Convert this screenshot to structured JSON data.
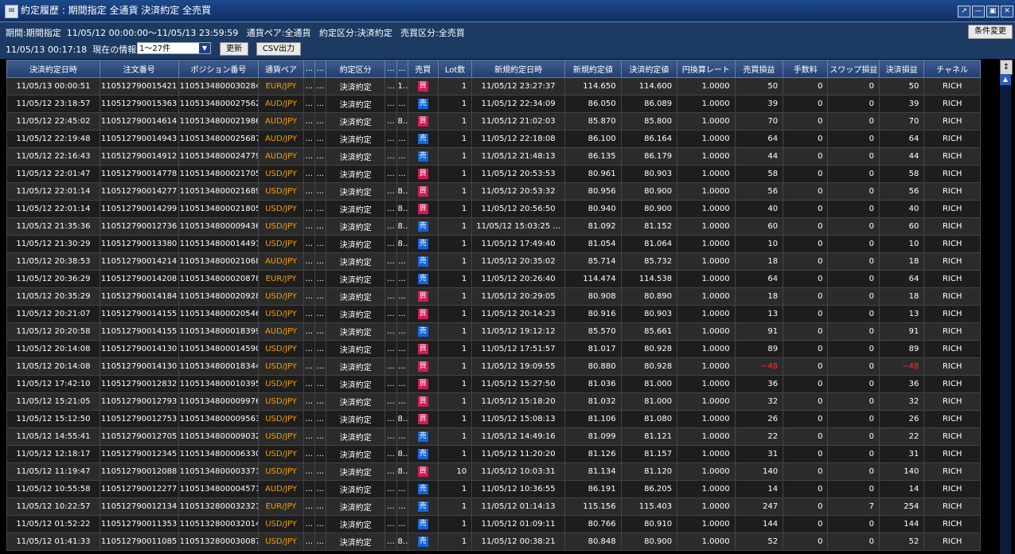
{
  "window": {
    "title": "約定履歴 : 期間指定 全通貨 決済約定 全売買",
    "buttons": [
      "↗",
      "—",
      "▣",
      "✕"
    ]
  },
  "info": {
    "period_line": "期間:期間指定  11/05/12 00:00:00〜11/05/13 23:59:59   通貨ペア:全通貨   約定区分:決済約定   売買区分:全売買",
    "now_line": "11/05/13 00:17:18  現在の情報",
    "condition_button": "条件変更",
    "range_select": "1〜27件",
    "refresh_button": "更新",
    "csv_button": "CSV出力"
  },
  "table": {
    "columns": [
      "決済約定日時",
      "注文番号",
      "ポジション番号",
      "通貨ペア",
      "...",
      "...",
      "約定区分",
      "...",
      "...",
      "売買",
      "Lot数",
      "新規約定日時",
      "新規約定値",
      "決済約定値",
      "円換算レート",
      "売買損益",
      "手数料",
      "スワップ損益",
      "決済損益",
      "チャネル"
    ],
    "rows": [
      [
        "11/05/13 00:00:51",
        "110512790015421 7",
        "1105134800030284",
        "EUR/JPY",
        "...",
        "...",
        "決済約定",
        "...",
        "1...",
        "買",
        "1",
        "11/05/12 23:27:37",
        "114.650",
        "114.600",
        "1.0000",
        "50",
        "0",
        "0",
        "50",
        "RICH"
      ],
      [
        "11/05/12 23:18:57",
        "110512790015363 1",
        "1105134800027562",
        "AUD/JPY",
        "...",
        "...",
        "決済約定",
        "...",
        "...",
        "売",
        "1",
        "11/05/12 22:34:09",
        "86.050",
        "86.089",
        "1.0000",
        "39",
        "0",
        "0",
        "39",
        "RICH"
      ],
      [
        "11/05/12 22:45:02",
        "110512790014614 7",
        "1105134800021986",
        "AUD/JPY",
        "...",
        "...",
        "決済約定",
        "...",
        "8...",
        "買",
        "1",
        "11/05/12 21:02:03",
        "85.870",
        "85.800",
        "1.0000",
        "70",
        "0",
        "0",
        "70",
        "RICH"
      ],
      [
        "11/05/12 22:19:48",
        "110512790014943 9",
        "1105134800025687",
        "AUD/JPY",
        "...",
        "...",
        "決済約定",
        "...",
        "...",
        "売",
        "1",
        "11/05/12 22:18:08",
        "86.100",
        "86.164",
        "1.0000",
        "64",
        "0",
        "0",
        "64",
        "RICH"
      ],
      [
        "11/05/12 22:16:43",
        "110512790014912 4",
        "1105134800024779",
        "AUD/JPY",
        "...",
        "...",
        "決済約定",
        "...",
        "...",
        "売",
        "1",
        "11/05/12 21:48:13",
        "86.135",
        "86.179",
        "1.0000",
        "44",
        "0",
        "0",
        "44",
        "RICH"
      ],
      [
        "11/05/12 22:01:47",
        "110512790014778 4",
        "1105134800021705",
        "USD/JPY",
        "...",
        "...",
        "決済約定",
        "...",
        "...",
        "買",
        "1",
        "11/05/12 20:53:53",
        "80.961",
        "80.903",
        "1.0000",
        "58",
        "0",
        "0",
        "58",
        "RICH"
      ],
      [
        "11/05/12 22:01:14",
        "110512790014277 5",
        "1105134800021689",
        "USD/JPY",
        "...",
        "...",
        "決済約定",
        "...",
        "8...",
        "買",
        "1",
        "11/05/12 20:53:32",
        "80.956",
        "80.900",
        "1.0000",
        "56",
        "0",
        "0",
        "56",
        "RICH"
      ],
      [
        "11/05/12 22:01:14",
        "110512790014299 1",
        "1105134800021805",
        "USD/JPY",
        "...",
        "...",
        "決済約定",
        "...",
        "8...",
        "買",
        "1",
        "11/05/12 20:56:50",
        "80.940",
        "80.900",
        "1.0000",
        "40",
        "0",
        "0",
        "40",
        "RICH"
      ],
      [
        "11/05/12 21:35:36",
        "110512790012736 7",
        "1105134800009436",
        "USD/JPY",
        "...",
        "...",
        "決済約定",
        "...",
        "8...",
        "売",
        "1",
        "11/05/12 15:03:25 ...",
        "81.092",
        "81.152",
        "1.0000",
        "60",
        "0",
        "0",
        "60",
        "RICH"
      ],
      [
        "11/05/12 21:30:29",
        "110512790013380 1",
        "1105134800014491",
        "USD/JPY",
        "...",
        "...",
        "決済約定",
        "...",
        "8...",
        "売",
        "1",
        "11/05/12 17:49:40",
        "81.054",
        "81.064",
        "1.0000",
        "10",
        "0",
        "0",
        "10",
        "RICH"
      ],
      [
        "11/05/12 20:38:53",
        "110512790014214 8",
        "1105134800021068",
        "AUD/JPY",
        "...",
        "...",
        "決済約定",
        "...",
        "...",
        "売",
        "1",
        "11/05/12 20:35:02",
        "85.714",
        "85.732",
        "1.0000",
        "18",
        "0",
        "0",
        "18",
        "RICH"
      ],
      [
        "11/05/12 20:36:29",
        "110512790014208 6",
        "1105134800020878",
        "EUR/JPY",
        "...",
        "...",
        "決済約定",
        "...",
        "...",
        "売",
        "1",
        "11/05/12 20:26:40",
        "114.474",
        "114.538",
        "1.0000",
        "64",
        "0",
        "0",
        "64",
        "RICH"
      ],
      [
        "11/05/12 20:35:29",
        "110512790014184 5",
        "1105134800020928",
        "USD/JPY",
        "...",
        "...",
        "決済約定",
        "...",
        "...",
        "買",
        "1",
        "11/05/12 20:29:05",
        "80.908",
        "80.890",
        "1.0000",
        "18",
        "0",
        "0",
        "18",
        "RICH"
      ],
      [
        "11/05/12 20:21:07",
        "110512790014155 6",
        "1105134800020546",
        "USD/JPY",
        "...",
        "...",
        "決済約定",
        "...",
        "...",
        "買",
        "1",
        "11/05/12 20:14:23",
        "80.916",
        "80.903",
        "1.0000",
        "13",
        "0",
        "0",
        "13",
        "RICH"
      ],
      [
        "11/05/12 20:20:58",
        "110512790014155 1",
        "1105134800018399",
        "AUD/JPY",
        "...",
        "...",
        "決済約定",
        "...",
        "...",
        "売",
        "1",
        "11/05/12 19:12:12",
        "85.570",
        "85.661",
        "1.0000",
        "91",
        "0",
        "0",
        "91",
        "RICH"
      ],
      [
        "11/05/12 20:14:08",
        "110512790014130 6",
        "1105134800014590",
        "USD/JPY",
        "...",
        "...",
        "決済約定",
        "...",
        "...",
        "買",
        "1",
        "11/05/12 17:51:57",
        "81.017",
        "80.928",
        "1.0000",
        "89",
        "0",
        "0",
        "89",
        "RICH"
      ],
      [
        "11/05/12 20:14:08",
        "110512790014130 5",
        "1105134800018344",
        "USD/JPY",
        "...",
        "...",
        "決済約定",
        "...",
        "...",
        "買",
        "1",
        "11/05/12 19:09:55",
        "80.880",
        "80.928",
        "1.0000",
        "−48",
        "0",
        "0",
        "−48",
        "RICH"
      ],
      [
        "11/05/12 17:42:10",
        "110512790012832 9",
        "1105134800010395",
        "USD/JPY",
        "...",
        "...",
        "決済約定",
        "...",
        "...",
        "買",
        "1",
        "11/05/12 15:27:50",
        "81.036",
        "81.000",
        "1.0000",
        "36",
        "0",
        "0",
        "36",
        "RICH"
      ],
      [
        "11/05/12 15:21:05",
        "110512790012793 1",
        "1105134800009976",
        "USD/JPY",
        "...",
        "...",
        "決済約定",
        "...",
        "...",
        "買",
        "1",
        "11/05/12 15:18:20",
        "81.032",
        "81.000",
        "1.0000",
        "32",
        "0",
        "0",
        "32",
        "RICH"
      ],
      [
        "11/05/12 15:12:50",
        "110512790012753 0",
        "1105134800009563",
        "USD/JPY",
        "...",
        "...",
        "決済約定",
        "...",
        "8...",
        "買",
        "1",
        "11/05/12 15:08:13",
        "81.106",
        "81.080",
        "1.0000",
        "26",
        "0",
        "0",
        "26",
        "RICH"
      ],
      [
        "11/05/12 14:55:41",
        "110512790012705 9",
        "1105134800009032",
        "USD/JPY",
        "...",
        "...",
        "決済約定",
        "...",
        "...",
        "売",
        "1",
        "11/05/12 14:49:16",
        "81.099",
        "81.121",
        "1.0000",
        "22",
        "0",
        "0",
        "22",
        "RICH"
      ],
      [
        "11/05/12 12:18:17",
        "110512790012345 3",
        "1105134800006330",
        "USD/JPY",
        "...",
        "...",
        "決済約定",
        "...",
        "8...",
        "売",
        "1",
        "11/05/12 11:20:20",
        "81.126",
        "81.157",
        "1.0000",
        "31",
        "0",
        "0",
        "31",
        "RICH"
      ],
      [
        "11/05/12 11:19:47",
        "110512790012088 7",
        "1105134800003371",
        "USD/JPY",
        "...",
        "...",
        "決済約定",
        "...",
        "8...",
        "買",
        "10",
        "11/05/12 10:03:31",
        "81.134",
        "81.120",
        "1.0000",
        "140",
        "0",
        "0",
        "140",
        "RICH"
      ],
      [
        "11/05/12 10:55:58",
        "110512790012277 9",
        "1105134800004571",
        "AUD/JPY",
        "...",
        "...",
        "決済約定",
        "...",
        "...",
        "売",
        "1",
        "11/05/12 10:36:55",
        "86.191",
        "86.205",
        "1.0000",
        "14",
        "0",
        "0",
        "14",
        "RICH"
      ],
      [
        "11/05/12 10:22:57",
        "110512790012134 5",
        "1105132800032321",
        "EUR/JPY",
        "...",
        "...",
        "決済約定",
        "...",
        "...",
        "売",
        "1",
        "11/05/12 01:14:13",
        "115.156",
        "115.403",
        "1.0000",
        "247",
        "0",
        "7",
        "254",
        "RICH"
      ],
      [
        "11/05/12 01:52:22",
        "110512790011353 6",
        "1105132800032014",
        "USD/JPY",
        "...",
        "...",
        "決済約定",
        "...",
        "...",
        "売",
        "1",
        "11/05/12 01:09:11",
        "80.766",
        "80.910",
        "1.0000",
        "144",
        "0",
        "0",
        "144",
        "RICH"
      ],
      [
        "11/05/12 01:41:33",
        "110512790011085 6",
        "1105132800030087",
        "USD/JPY",
        "...",
        "...",
        "決済約定",
        "...",
        "8...",
        "売",
        "1",
        "11/05/12 00:38:21",
        "80.848",
        "80.900",
        "1.0000",
        "52",
        "0",
        "0",
        "52",
        "RICH"
      ]
    ]
  },
  "colors": {
    "sell": "#1565d8",
    "buy": "#d01c55",
    "pair": "#f0a000",
    "negative": "#ff3030"
  },
  "scroll_corner": "↕",
  "scroll_up": "▲"
}
